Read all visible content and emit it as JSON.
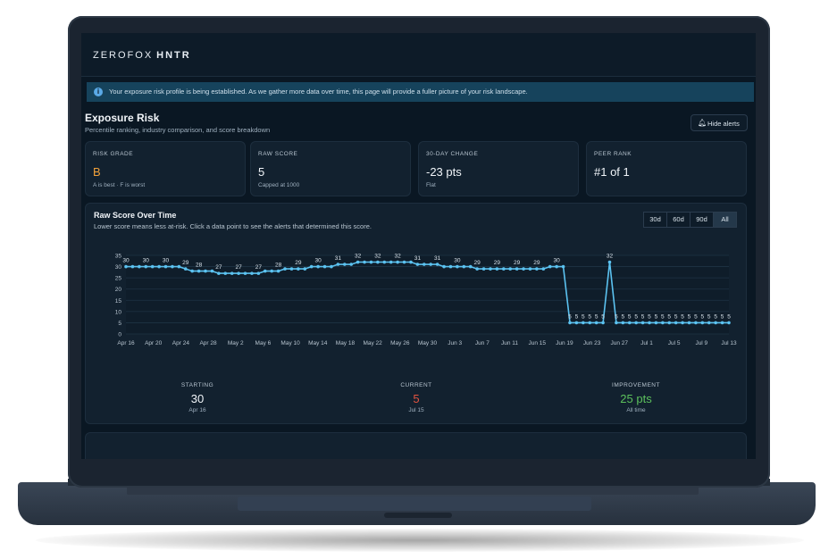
{
  "app": {
    "logo_text": "ZEROFOX",
    "logo_product": "HNTR"
  },
  "banner": {
    "text": "Your exposure risk profile is being established. As we gather more data over time, this page will provide a fuller picture of your risk landscape."
  },
  "header": {
    "title": "Exposure Risk",
    "subtitle": "Percentile ranking, industry comparison, and score breakdown",
    "hide_alerts_label": "Hide alerts"
  },
  "cards": [
    {
      "label": "RISK GRADE",
      "value": "B",
      "note": "A is best · F is worst",
      "color": "#f0a13a"
    },
    {
      "label": "RAW SCORE",
      "value": "5",
      "note": "Capped at 1000",
      "color": "#f1f5f9"
    },
    {
      "label": "30-DAY CHANGE",
      "value": "-23 pts",
      "note": "Flat",
      "color": "#f1f5f9"
    },
    {
      "label": "PEER RANK",
      "value": "#1 of 1",
      "note": "",
      "color": "#f1f5f9"
    }
  ],
  "panel": {
    "title": "Raw Score Over Time",
    "subtitle": "Lower score means less at-risk. Click a data point to see the alerts that determined this score.",
    "ranges": [
      "30d",
      "60d",
      "90d",
      "All"
    ],
    "active_range": "All"
  },
  "stats": [
    {
      "label": "STARTING",
      "value": "30",
      "date": "Apr 16",
      "color": "#f1f5f9"
    },
    {
      "label": "CURRENT",
      "value": "5",
      "date": "Jul 15",
      "color": "#e0533f"
    },
    {
      "label": "IMPROVEMENT",
      "value": "25 pts",
      "date": "All time",
      "color": "#5cc05c"
    }
  ],
  "chart_data": {
    "type": "line",
    "title": "Raw Score Over Time",
    "ylim": [
      0,
      35
    ],
    "yticks": [
      0,
      5,
      10,
      15,
      20,
      25,
      30,
      35
    ],
    "xtick_labels": [
      "Apr 16",
      "Apr 20",
      "Apr 24",
      "Apr 28",
      "May 2",
      "May 6",
      "May 10",
      "May 14",
      "May 18",
      "May 22",
      "May 26",
      "May 30",
      "Jun 3",
      "Jun 7",
      "Jun 11",
      "Jun 15",
      "Jun 19",
      "Jun 23",
      "Jun 27",
      "Jul 1",
      "Jul 5",
      "Jul 9",
      "Jul 13"
    ],
    "grid": true,
    "line_color": "#5bc2f0",
    "series": [
      {
        "values": [
          30,
          30,
          30,
          30,
          30,
          30,
          30,
          30,
          30,
          29,
          28,
          28,
          28,
          28,
          27,
          27,
          27,
          27,
          27,
          27,
          27,
          28,
          28,
          28,
          29,
          29,
          29,
          29,
          30,
          30,
          30,
          30,
          31,
          31,
          31,
          32,
          32,
          32,
          32,
          32,
          32,
          32,
          32,
          32,
          31,
          31,
          31,
          31,
          30,
          30,
          30,
          30,
          30,
          29,
          29,
          29,
          29,
          29,
          29,
          29,
          29,
          29,
          29,
          29,
          30,
          30,
          30,
          5,
          5,
          5,
          5,
          5,
          5,
          32,
          5,
          5,
          5,
          5,
          5,
          5,
          5,
          5,
          5,
          5,
          5,
          5,
          5,
          5,
          5,
          5,
          5,
          5
        ],
        "labels": [
          {
            "i": 0,
            "t": "30"
          },
          {
            "i": 3,
            "t": "30"
          },
          {
            "i": 6,
            "t": "30"
          },
          {
            "i": 9,
            "t": "29"
          },
          {
            "i": 11,
            "t": "28"
          },
          {
            "i": 14,
            "t": "27"
          },
          {
            "i": 17,
            "t": "27"
          },
          {
            "i": 20,
            "t": "27"
          },
          {
            "i": 23,
            "t": "28"
          },
          {
            "i": 26,
            "t": "29"
          },
          {
            "i": 29,
            "t": "30"
          },
          {
            "i": 32,
            "t": "31"
          },
          {
            "i": 35,
            "t": "32"
          },
          {
            "i": 38,
            "t": "32"
          },
          {
            "i": 41,
            "t": "32"
          },
          {
            "i": 44,
            "t": "31"
          },
          {
            "i": 47,
            "t": "31"
          },
          {
            "i": 50,
            "t": "30"
          },
          {
            "i": 53,
            "t": "29"
          },
          {
            "i": 56,
            "t": "29"
          },
          {
            "i": 59,
            "t": "29"
          },
          {
            "i": 62,
            "t": "29"
          },
          {
            "i": 65,
            "t": "30"
          },
          {
            "i": 67,
            "t": "5"
          },
          {
            "i": 68,
            "t": "5"
          },
          {
            "i": 69,
            "t": "5"
          },
          {
            "i": 70,
            "t": "5"
          },
          {
            "i": 71,
            "t": "5"
          },
          {
            "i": 72,
            "t": "5"
          },
          {
            "i": 73,
            "t": "32"
          },
          {
            "i": 74,
            "t": "5"
          },
          {
            "i": 75,
            "t": "5"
          },
          {
            "i": 76,
            "t": "5"
          },
          {
            "i": 77,
            "t": "5"
          },
          {
            "i": 78,
            "t": "5"
          },
          {
            "i": 79,
            "t": "5"
          },
          {
            "i": 80,
            "t": "5"
          },
          {
            "i": 81,
            "t": "5"
          },
          {
            "i": 82,
            "t": "5"
          },
          {
            "i": 83,
            "t": "5"
          },
          {
            "i": 84,
            "t": "5"
          },
          {
            "i": 85,
            "t": "5"
          },
          {
            "i": 86,
            "t": "5"
          },
          {
            "i": 87,
            "t": "5"
          },
          {
            "i": 88,
            "t": "5"
          },
          {
            "i": 89,
            "t": "5"
          },
          {
            "i": 90,
            "t": "5"
          },
          {
            "i": 91,
            "t": "5"
          }
        ]
      }
    ]
  }
}
